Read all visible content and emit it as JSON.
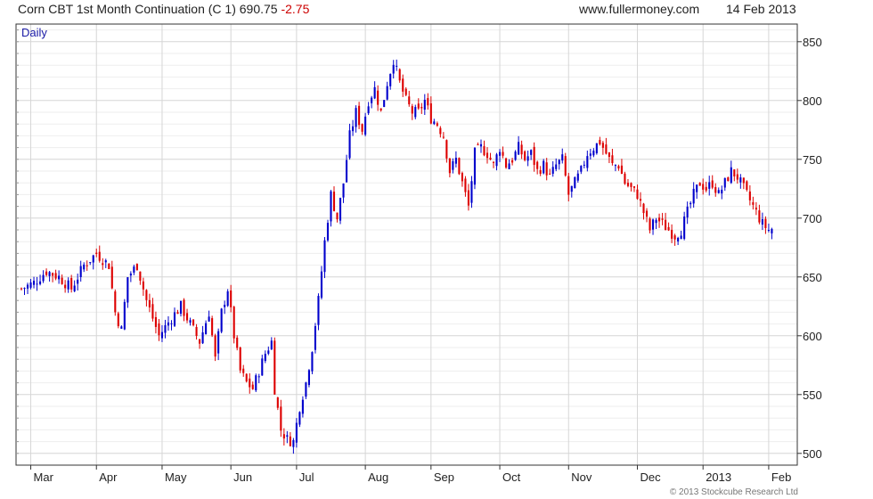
{
  "header": {
    "instrument": "Corn CBT 1st Month Continuation (C 1)",
    "last": "690.75",
    "change": "-2.75",
    "site": "www.fullermoney.com",
    "date": "14 Feb 2013"
  },
  "footer": {
    "credit": "© 2013 Stockcube Research Ltd"
  },
  "colors": {
    "up": "#0000cc",
    "down": "#dd0000",
    "grid_major": "#d6d6d6",
    "grid_minor": "#eeeeee",
    "axis": "#333333"
  },
  "chart_data": {
    "type": "candlestick",
    "period_label": "Daily",
    "y_axis": {
      "position": "right",
      "ticks": [
        500,
        550,
        600,
        650,
        700,
        750,
        800,
        850
      ],
      "range": [
        490,
        865
      ]
    },
    "x_axis": {
      "labels": [
        "Mar",
        "Apr",
        "May",
        "Jun",
        "Jul",
        "Aug",
        "Sep",
        "Oct",
        "Nov",
        "Dec",
        "2013",
        "Feb"
      ],
      "label_positions": [
        3,
        24,
        45,
        67,
        88,
        110,
        131,
        153,
        175,
        197,
        218,
        239
      ],
      "bar_count": 247
    },
    "close_path": [
      [
        0,
        640
      ],
      [
        4,
        645
      ],
      [
        8,
        655
      ],
      [
        12,
        650
      ],
      [
        16,
        640
      ],
      [
        20,
        660
      ],
      [
        24,
        670
      ],
      [
        28,
        660
      ],
      [
        30,
        620
      ],
      [
        32,
        605
      ],
      [
        34,
        650
      ],
      [
        37,
        660
      ],
      [
        40,
        630
      ],
      [
        44,
        600
      ],
      [
        48,
        615
      ],
      [
        51,
        625
      ],
      [
        54,
        610
      ],
      [
        57,
        595
      ],
      [
        60,
        620
      ],
      [
        62,
        580
      ],
      [
        64,
        620
      ],
      [
        66,
        640
      ],
      [
        68,
        600
      ],
      [
        70,
        570
      ],
      [
        72,
        560
      ],
      [
        74,
        555
      ],
      [
        76,
        570
      ],
      [
        78,
        585
      ],
      [
        80,
        595
      ],
      [
        81,
        555
      ],
      [
        83,
        520
      ],
      [
        85,
        512
      ],
      [
        87,
        510
      ],
      [
        89,
        540
      ],
      [
        91,
        560
      ],
      [
        93,
        590
      ],
      [
        95,
        630
      ],
      [
        97,
        680
      ],
      [
        99,
        720
      ],
      [
        101,
        700
      ],
      [
        103,
        730
      ],
      [
        105,
        770
      ],
      [
        107,
        790
      ],
      [
        109,
        775
      ],
      [
        111,
        800
      ],
      [
        113,
        810
      ],
      [
        115,
        790
      ],
      [
        117,
        815
      ],
      [
        119,
        835
      ],
      [
        121,
        815
      ],
      [
        123,
        800
      ],
      [
        125,
        790
      ],
      [
        127,
        790
      ],
      [
        129,
        800
      ],
      [
        131,
        785
      ],
      [
        133,
        780
      ],
      [
        135,
        770
      ],
      [
        137,
        740
      ],
      [
        139,
        750
      ],
      [
        141,
        730
      ],
      [
        143,
        710
      ],
      [
        145,
        755
      ],
      [
        147,
        760
      ],
      [
        149,
        755
      ],
      [
        151,
        745
      ],
      [
        153,
        760
      ],
      [
        155,
        745
      ],
      [
        157,
        750
      ],
      [
        159,
        760
      ],
      [
        161,
        750
      ],
      [
        163,
        755
      ],
      [
        165,
        740
      ],
      [
        167,
        745
      ],
      [
        169,
        735
      ],
      [
        171,
        745
      ],
      [
        173,
        750
      ],
      [
        175,
        720
      ],
      [
        177,
        730
      ],
      [
        179,
        740
      ],
      [
        181,
        755
      ],
      [
        183,
        760
      ],
      [
        185,
        765
      ],
      [
        187,
        755
      ],
      [
        189,
        745
      ],
      [
        191,
        745
      ],
      [
        193,
        730
      ],
      [
        195,
        725
      ],
      [
        197,
        720
      ],
      [
        199,
        705
      ],
      [
        201,
        690
      ],
      [
        203,
        700
      ],
      [
        205,
        695
      ],
      [
        207,
        690
      ],
      [
        209,
        685
      ],
      [
        211,
        690
      ],
      [
        213,
        705
      ],
      [
        215,
        720
      ],
      [
        217,
        730
      ],
      [
        219,
        725
      ],
      [
        221,
        730
      ],
      [
        223,
        720
      ],
      [
        225,
        730
      ],
      [
        227,
        740
      ],
      [
        229,
        735
      ],
      [
        231,
        725
      ],
      [
        233,
        715
      ],
      [
        235,
        705
      ],
      [
        237,
        695
      ],
      [
        239,
        690
      ],
      [
        240,
        691
      ]
    ]
  }
}
